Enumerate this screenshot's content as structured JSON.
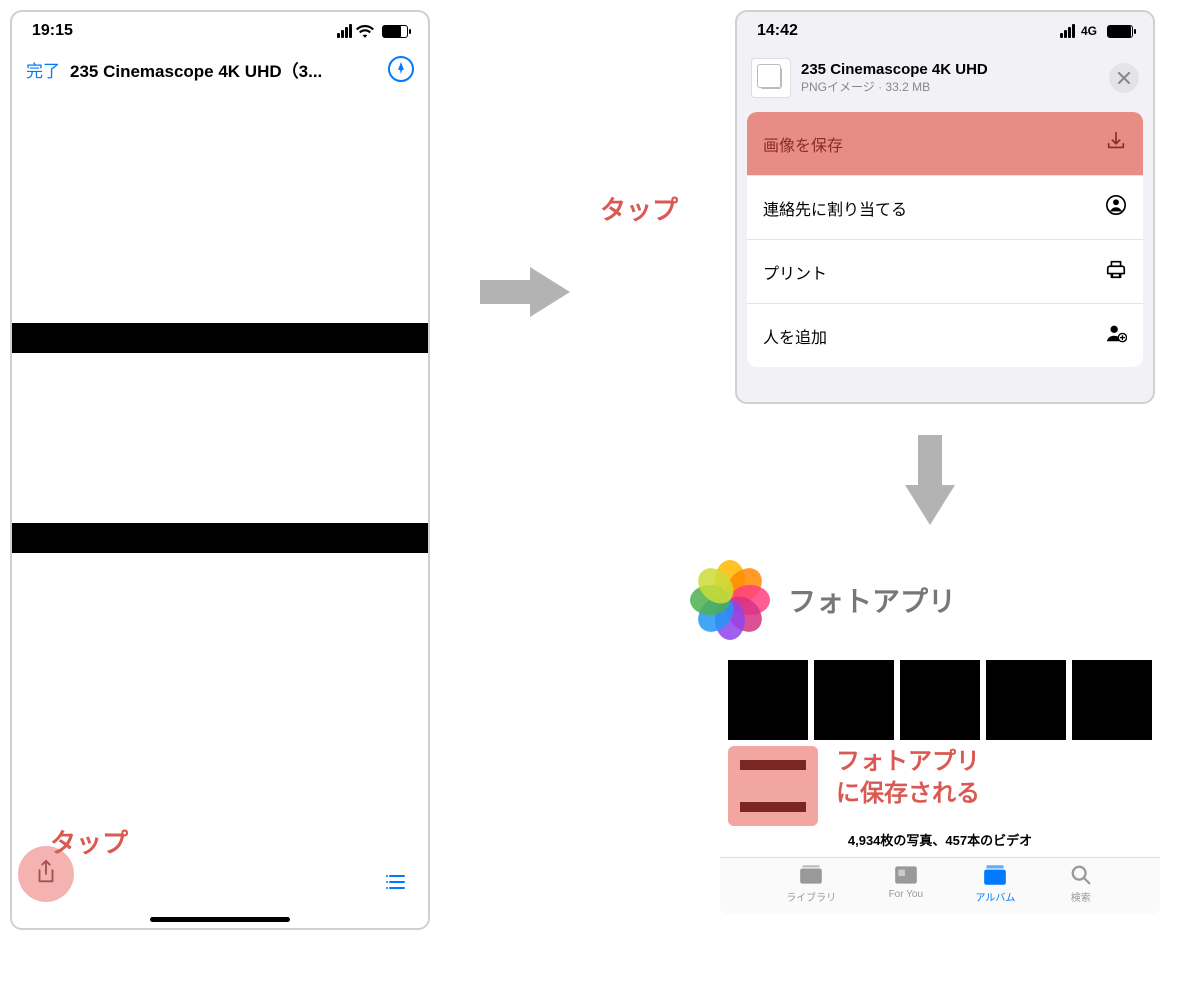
{
  "left": {
    "time": "19:15",
    "done": "完了",
    "title": "235 Cinemascope 4K UHD（3...",
    "tap_label": "タップ"
  },
  "arrow_tap": "タップ",
  "sheet": {
    "time": "14:42",
    "net": "4G",
    "file_name": "235 Cinemascope 4K UHD",
    "file_meta": "PNGイメージ · 33.2 MB",
    "actions": {
      "save": "画像を保存",
      "assign": "連絡先に割り当てる",
      "print": "プリント",
      "add_person": "人を追加"
    }
  },
  "photos": {
    "title": "フォトアプリ",
    "saved_line1": "フォトアプリ",
    "saved_line2": "に保存される",
    "count": "4,934枚の写真、457本のビデオ",
    "tabs": {
      "library": "ライブラリ",
      "foryou": "For You",
      "album": "アルバム",
      "search": "検索"
    }
  }
}
